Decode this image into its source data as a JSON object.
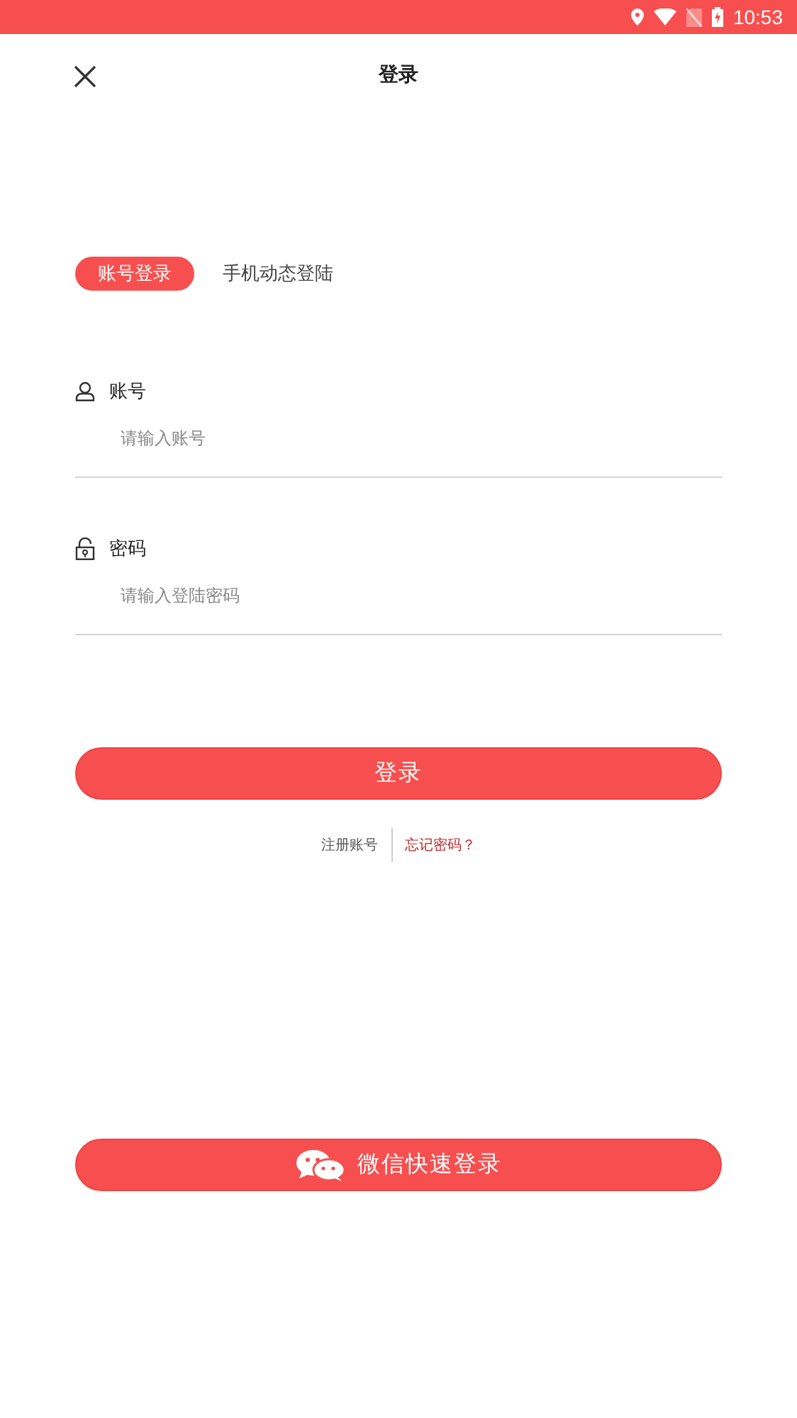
{
  "status_bar": {
    "time": "10:53"
  },
  "header": {
    "title": "登录"
  },
  "tabs": [
    {
      "label": "账号登录",
      "selected": true
    },
    {
      "label": "手机动态登陆",
      "selected": false
    }
  ],
  "fields": [
    {
      "kind": "user",
      "label": "账号",
      "placeholder": "请输入账号"
    },
    {
      "kind": "lock",
      "label": "密码",
      "placeholder": "请输入登陆密码"
    }
  ],
  "login_button": "登录",
  "links": [
    {
      "label": "注册账号",
      "kind": "plain"
    },
    {
      "label": "忘记密码？",
      "kind": "accent"
    }
  ],
  "wechat_button": "微信快速登录"
}
